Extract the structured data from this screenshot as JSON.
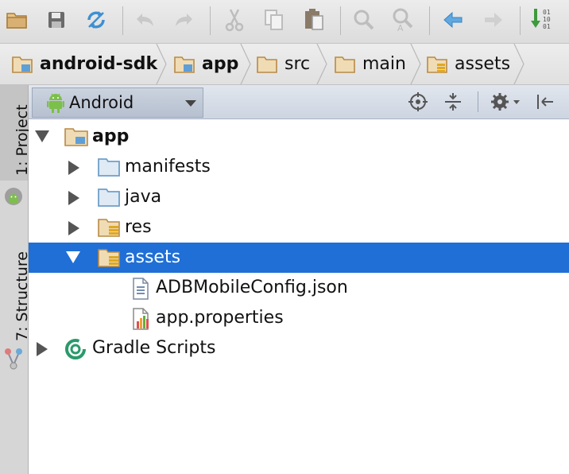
{
  "toolbar": {
    "buttons": [
      {
        "name": "open-folder-icon"
      },
      {
        "name": "save-icon"
      },
      {
        "name": "sync-icon"
      },
      {
        "name": "undo-icon"
      },
      {
        "name": "redo-icon"
      },
      {
        "name": "cut-icon"
      },
      {
        "name": "copy-icon"
      },
      {
        "name": "paste-icon"
      },
      {
        "name": "find-icon"
      },
      {
        "name": "replace-icon"
      },
      {
        "name": "back-icon"
      },
      {
        "name": "forward-icon"
      },
      {
        "name": "make-project-icon"
      }
    ],
    "make_icon_text": "01\n10\n01"
  },
  "breadcrumb": [
    "android-sdk",
    "app",
    "src",
    "main",
    "assets"
  ],
  "sidebar": {
    "project_tab": "1: Project",
    "structure_tab": "7: Structure"
  },
  "panel": {
    "view_mode": "Android"
  },
  "tree": [
    {
      "label": "app",
      "icon": "module-folder-icon",
      "expanded": true,
      "level": 0
    },
    {
      "label": "manifests",
      "icon": "folder-icon",
      "expanded": false,
      "level": 1
    },
    {
      "label": "java",
      "icon": "folder-icon",
      "expanded": false,
      "level": 1
    },
    {
      "label": "res",
      "icon": "resource-folder-icon",
      "expanded": false,
      "level": 1
    },
    {
      "label": "assets",
      "icon": "resource-folder-icon",
      "expanded": true,
      "level": 1,
      "selected": true
    },
    {
      "label": "ADBMobileConfig.json",
      "icon": "json-file-icon",
      "level": 2
    },
    {
      "label": "app.properties",
      "icon": "properties-file-icon",
      "level": 2
    },
    {
      "label": "Gradle Scripts",
      "icon": "gradle-icon",
      "expanded": false,
      "level": 0
    }
  ],
  "colors": {
    "selection": "#1f6fd6",
    "folder": "#c9a46a",
    "module": "#5f9fd6"
  }
}
